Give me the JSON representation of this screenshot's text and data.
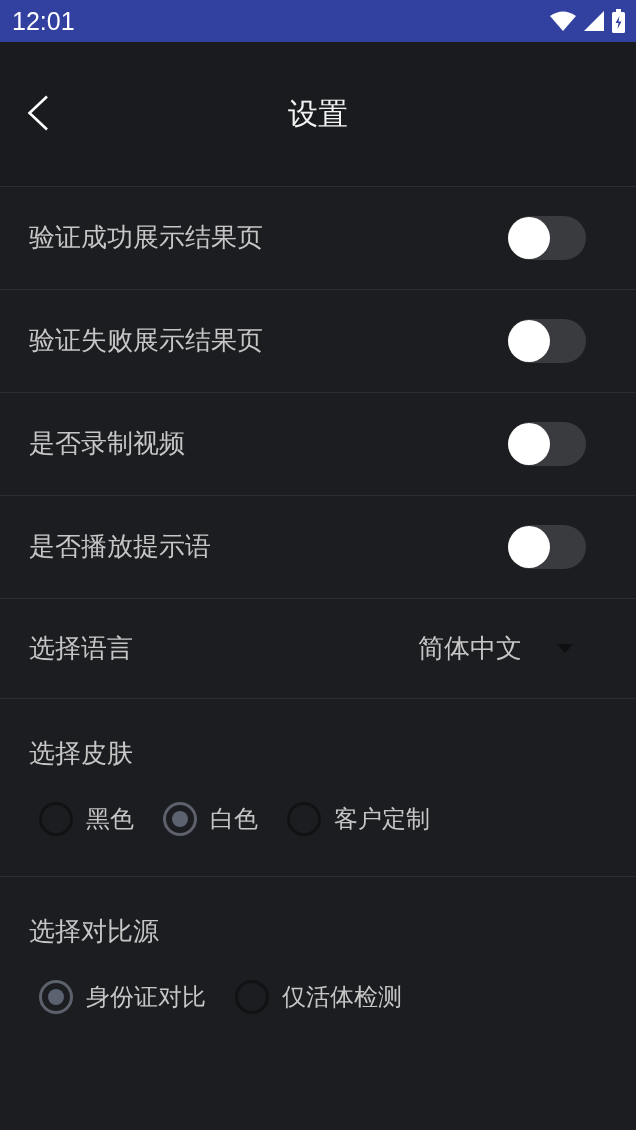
{
  "status_bar": {
    "time": "12:01"
  },
  "header": {
    "title": "设置"
  },
  "toggles": [
    {
      "label": "验证成功展示结果页",
      "on": false
    },
    {
      "label": "验证失败展示结果页",
      "on": false
    },
    {
      "label": "是否录制视频",
      "on": false
    },
    {
      "label": "是否播放提示语",
      "on": false
    }
  ],
  "language": {
    "label": "选择语言",
    "value": "简体中文"
  },
  "skin": {
    "label": "选择皮肤",
    "options": [
      {
        "label": "黑色",
        "selected": false
      },
      {
        "label": "白色",
        "selected": true
      },
      {
        "label": "客户定制",
        "selected": false
      }
    ]
  },
  "source": {
    "label": "选择对比源",
    "options": [
      {
        "label": "身份证对比",
        "selected": true
      },
      {
        "label": "仅活体检测",
        "selected": false
      }
    ]
  }
}
